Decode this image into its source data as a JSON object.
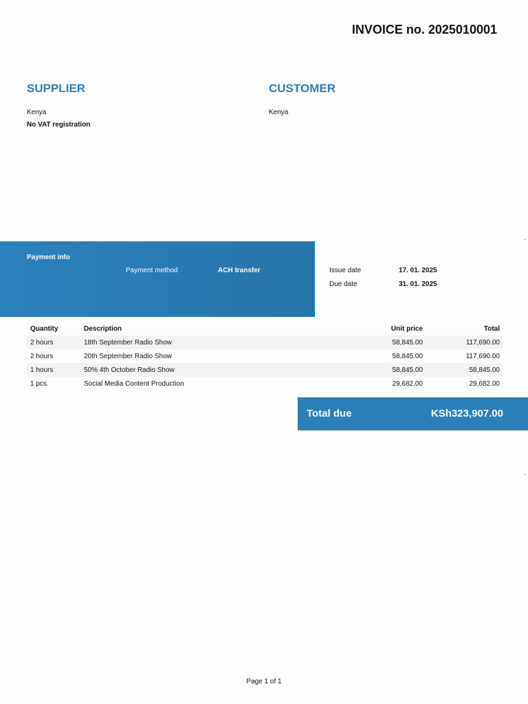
{
  "invoice_title": "INVOICE no. 2025010001",
  "supplier": {
    "heading": "SUPPLIER",
    "country": "Kenya",
    "vat": "No VAT registration"
  },
  "customer": {
    "heading": "CUSTOMER",
    "country": "Kenya"
  },
  "payment": {
    "heading": "Payment info",
    "method_label": "Payment method",
    "method_value": "ACH transfer"
  },
  "dates": {
    "issue_label": "Issue date",
    "issue_value": "17. 01. 2025",
    "due_label": "Due date",
    "due_value": "31. 01. 2025"
  },
  "table": {
    "headers": [
      "Quantity",
      "Description",
      "Unit price",
      "Total"
    ],
    "rows": [
      [
        "2 hours",
        "18th September Radio Show",
        "58,845.00",
        "117,690.00"
      ],
      [
        "2 hours",
        "20th September Radio Show",
        "58,845.00",
        "117,690.00"
      ],
      [
        "1 hours",
        "50% 4th October Radio Show",
        "58,845.00",
        "58,845.00"
      ],
      [
        "1 pcs.",
        "Social Media Content Production",
        "29,682.00",
        "29,682.00"
      ]
    ]
  },
  "total": {
    "label": "Total due",
    "value": "KSh323,907.00"
  },
  "footer": {
    "page": "Page 1 of 1"
  },
  "marks": {
    "fold_mark": ".."
  },
  "colors": {
    "accent": "#2a7fc0"
  }
}
